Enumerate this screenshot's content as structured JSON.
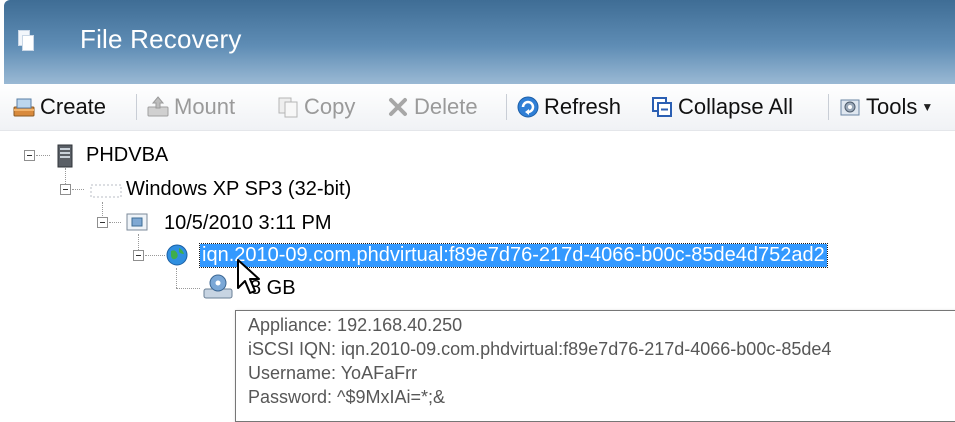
{
  "window": {
    "title": "File Recovery"
  },
  "toolbar": {
    "create": "Create",
    "mount": "Mount",
    "copy": "Copy",
    "delete": "Delete",
    "refresh": "Refresh",
    "collapse_all": "Collapse All",
    "tools": "Tools"
  },
  "tree": {
    "host": "PHDVBA",
    "vm": "Windows XP SP3 (32-bit)",
    "backup": "10/5/2010 3:11 PM",
    "target": "iqn.2010-09.com.phdvirtual:f89e7d76-217d-4066-b00c-85de4d752ad2",
    "disk": "8 GB"
  },
  "tooltip": {
    "appliance": "Appliance: 192.168.40.250",
    "iqn": "iSCSI IQN: iqn.2010-09.com.phdvirtual:f89e7d76-217d-4066-b00c-85de4",
    "username": "Username:  YoAFaFrr",
    "password": "Password:   ^$9MxIAi=*;&"
  },
  "colors": {
    "titlebar": "#4f7ea8",
    "selection": "#3399ff"
  }
}
